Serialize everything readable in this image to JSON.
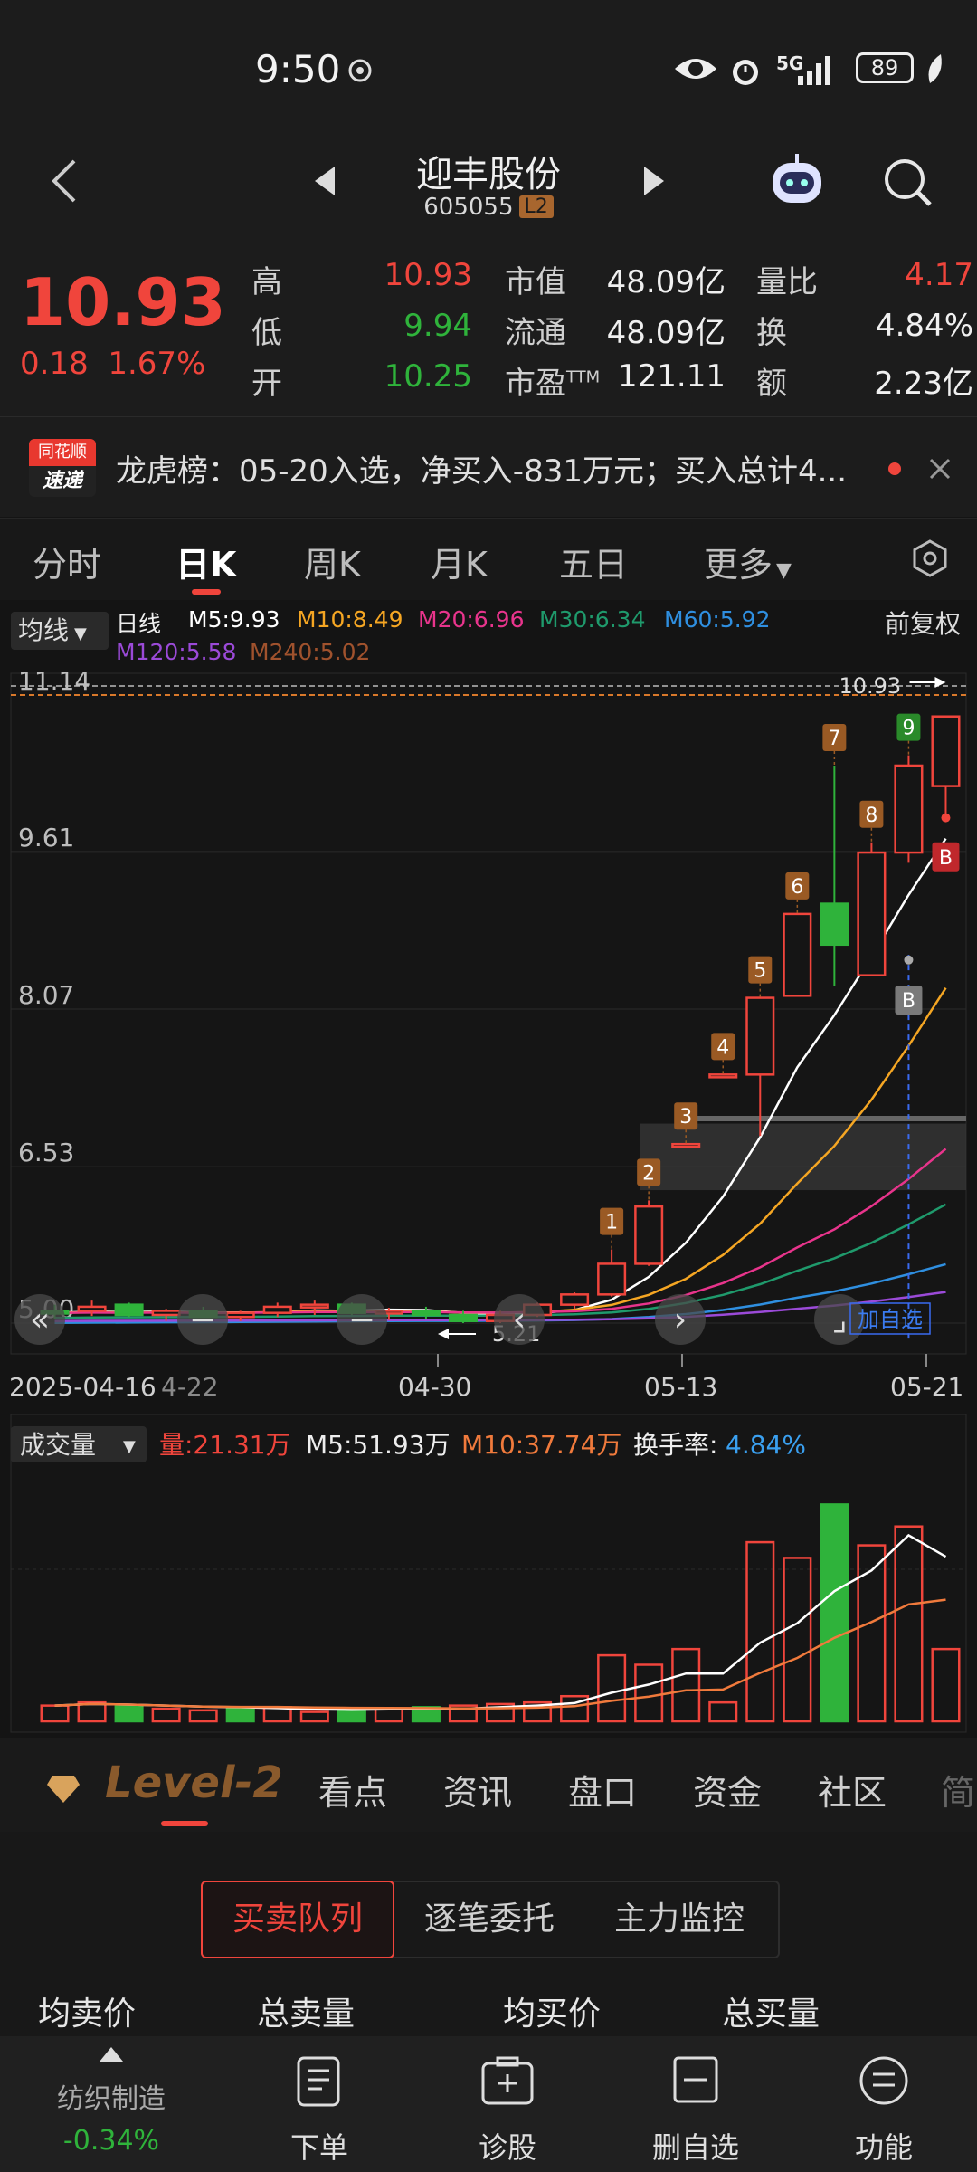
{
  "status_bar": {
    "time": "9:50",
    "network": "5G",
    "battery": "89"
  },
  "header": {
    "stock_name": "迎丰股份",
    "stock_code": "605055",
    "badge": "L2"
  },
  "quote": {
    "price": "10.93",
    "change": "0.18",
    "change_pct": "1.67%",
    "high_label": "高",
    "high": "10.93",
    "low_label": "低",
    "low": "9.94",
    "open_label": "开",
    "open": "10.25",
    "mktcap_label": "市值",
    "mktcap": "48.09亿",
    "float_label": "流通",
    "float": "48.09亿",
    "pe_label": "市盈",
    "pe_suffix": "TTM",
    "pe": "121.11",
    "volratio_label": "量比",
    "volratio": "4.17",
    "turnover_label": "换",
    "turnover": "4.84%",
    "amount_label": "额",
    "amount": "2.23亿"
  },
  "news": {
    "logo_top": "同花顺",
    "logo_bottom": "速递",
    "text": "龙虎榜：05-20入选，净买入-831万元；买入总计4..."
  },
  "tabs": [
    "分时",
    "日K",
    "周K",
    "月K",
    "五日",
    "更多"
  ],
  "ma": {
    "selector": "均线",
    "period": "日线",
    "adjust": "前复权",
    "items": [
      {
        "label": "M5:9.93",
        "color": "#ffffff"
      },
      {
        "label": "M10:8.49",
        "color": "#f5a623"
      },
      {
        "label": "M20:6.96",
        "color": "#e8348c"
      },
      {
        "label": "M30:6.34",
        "color": "#1f9a6c"
      },
      {
        "label": "M60:5.92",
        "color": "#2f8fe0"
      },
      {
        "label": "M120:5.58",
        "color": "#9b4ad8"
      },
      {
        "label": "M240:5.02",
        "color": "#a0522d"
      }
    ]
  },
  "chart_data": {
    "type": "candlestick",
    "y_ticks": [
      "11.14",
      "9.61",
      "8.07",
      "6.53",
      "5.00"
    ],
    "ylim": [
      5.0,
      11.14
    ],
    "x_ticks": [
      "2025-04-16",
      "4-22",
      "04-30",
      "05-13",
      "05-21"
    ],
    "candles": [
      {
        "o": 5.12,
        "h": 5.18,
        "l": 5.04,
        "c": 5.1
      },
      {
        "o": 5.12,
        "h": 5.22,
        "l": 5.07,
        "c": 5.16
      },
      {
        "o": 5.18,
        "h": 5.2,
        "l": 5.06,
        "c": 5.08
      },
      {
        "o": 5.08,
        "h": 5.14,
        "l": 5.02,
        "c": 5.12
      },
      {
        "o": 5.12,
        "h": 5.16,
        "l": 5.05,
        "c": 5.06
      },
      {
        "o": 5.06,
        "h": 5.12,
        "l": 5.02,
        "c": 5.1
      },
      {
        "o": 5.1,
        "h": 5.2,
        "l": 5.06,
        "c": 5.16
      },
      {
        "o": 5.16,
        "h": 5.22,
        "l": 5.08,
        "c": 5.18
      },
      {
        "o": 5.18,
        "h": 5.2,
        "l": 5.08,
        "c": 5.1
      },
      {
        "o": 5.1,
        "h": 5.15,
        "l": 5.03,
        "c": 5.12
      },
      {
        "o": 5.12,
        "h": 5.16,
        "l": 5.04,
        "c": 5.08
      },
      {
        "o": 5.08,
        "h": 5.12,
        "l": 5.0,
        "c": 5.02
      },
      {
        "o": 5.02,
        "h": 5.12,
        "l": 5.0,
        "c": 5.08
      },
      {
        "o": 5.08,
        "h": 5.2,
        "l": 5.06,
        "c": 5.18
      },
      {
        "o": 5.18,
        "h": 5.3,
        "l": 5.14,
        "c": 5.28
      },
      {
        "o": 5.28,
        "h": 5.72,
        "l": 5.26,
        "c": 5.58
      },
      {
        "o": 5.58,
        "h": 6.2,
        "l": 5.56,
        "c": 6.14
      },
      {
        "o": 6.75,
        "h": 6.75,
        "l": 6.75,
        "c": 6.75
      },
      {
        "o": 7.43,
        "h": 7.43,
        "l": 7.43,
        "c": 7.43
      },
      {
        "o": 7.43,
        "h": 8.18,
        "l": 6.83,
        "c": 8.18
      },
      {
        "o": 8.2,
        "h": 9.0,
        "l": 8.2,
        "c": 9.0
      },
      {
        "o": 9.1,
        "h": 10.45,
        "l": 8.3,
        "c": 8.7
      },
      {
        "o": 8.4,
        "h": 9.7,
        "l": 8.4,
        "c": 9.6
      },
      {
        "o": 9.6,
        "h": 10.55,
        "l": 9.5,
        "c": 10.45
      },
      {
        "o": 10.25,
        "h": 10.93,
        "l": 9.94,
        "c": 10.93
      }
    ],
    "markers": [
      "1",
      "2",
      "3",
      "4",
      "5",
      "6",
      "7",
      "8",
      "9"
    ],
    "max_label": "10.93",
    "min_label": "5.21",
    "buy_marker": "B",
    "add_watch_label": "加自选",
    "volume": {
      "selector": "成交量",
      "vol_label": "量:21.31万",
      "m5_label": "M5:51.93万",
      "m10_label": "M10:37.74万",
      "turnover_prefix": "换手率:",
      "turnover_value": "4.84%",
      "bars": [
        0.5,
        0.6,
        0.5,
        0.4,
        0.35,
        0.4,
        0.45,
        0.3,
        0.35,
        0.4,
        0.45,
        0.5,
        0.55,
        0.6,
        0.8,
        2.1,
        1.8,
        2.3,
        0.6,
        5.7,
        5.2,
        6.9,
        5.6,
        6.2,
        2.3
      ],
      "up": [
        true,
        true,
        false,
        true,
        true,
        false,
        true,
        true,
        false,
        true,
        false,
        true,
        true,
        true,
        true,
        true,
        true,
        true,
        true,
        true,
        true,
        false,
        true,
        true,
        true
      ]
    }
  },
  "level2": {
    "logo": "Level-2",
    "tabs": [
      "看点",
      "资讯",
      "盘口",
      "资金",
      "社区",
      "简"
    ],
    "segments": [
      "买卖队列",
      "逐笔委托",
      "主力监控"
    ],
    "headers": [
      "均卖价",
      "总卖量",
      "均买价",
      "总买量"
    ]
  },
  "bottom_nav": {
    "sector_name": "纺织制造",
    "sector_change": "-0.34%",
    "items": [
      "下单",
      "诊股",
      "删自选",
      "功能"
    ]
  }
}
